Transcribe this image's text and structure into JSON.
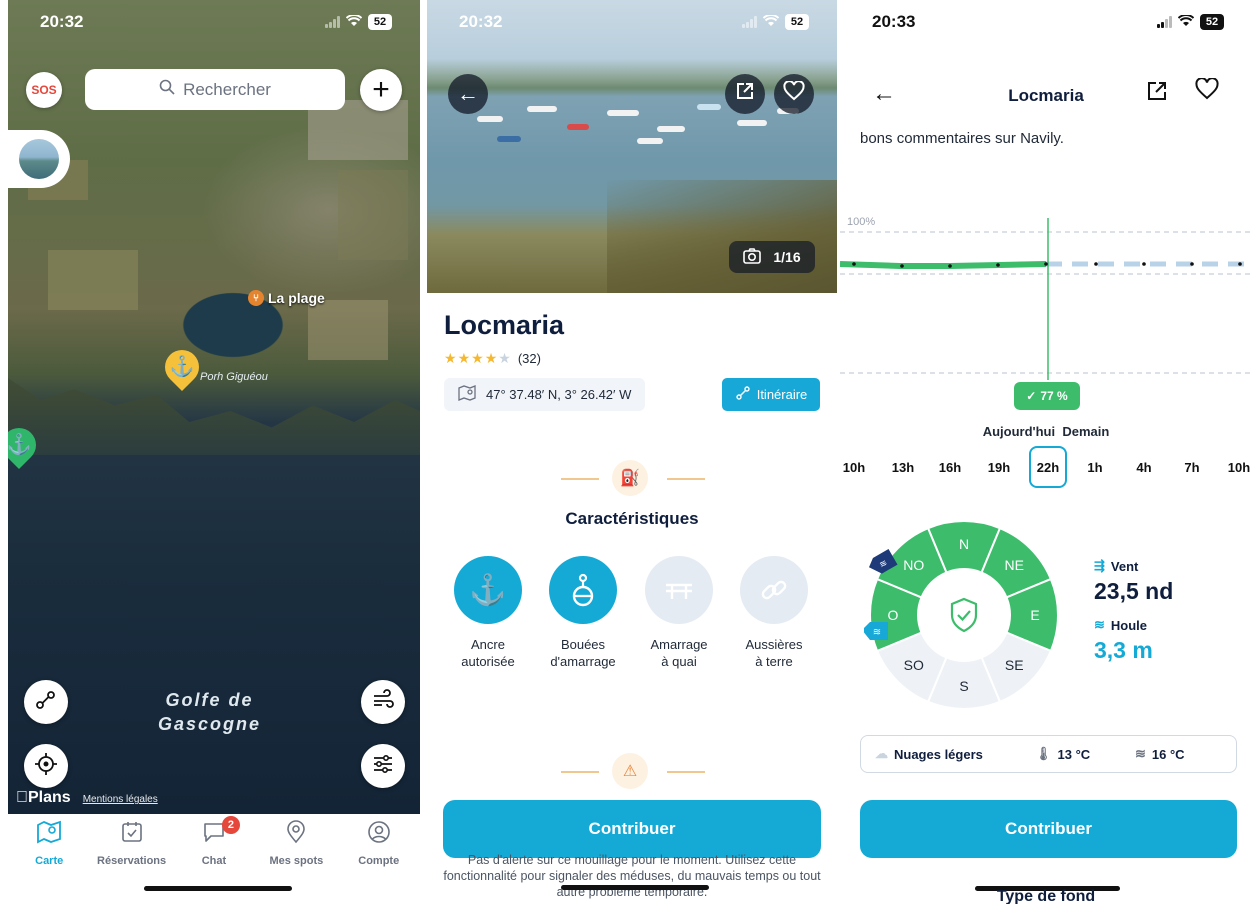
{
  "colors": {
    "accent": "#15a9d6",
    "navy": "#0f1e3d",
    "green": "#3dbd6c",
    "sos_red": "#e5473b",
    "star": "#f5b82e",
    "anchor_yellow": "#f6c13a",
    "anchor_green": "#2fb66b"
  },
  "panel_map": {
    "time": "20:32",
    "battery": "52",
    "sos_label": "SOS",
    "search": {
      "placeholder": "Rechercher",
      "icon": "search-icon"
    },
    "poi_label": "La plage",
    "anchorage_label": "Porh Giguéou",
    "sea_label_line1": "Golfe de",
    "sea_label_line2": "Gascogne",
    "plans_label": "Plans",
    "legal_label": "Mentions légales",
    "tabs": [
      {
        "label": "Carte",
        "icon": "map-icon",
        "active": true
      },
      {
        "label": "Réservations",
        "icon": "calendar-check-icon"
      },
      {
        "label": "Chat",
        "icon": "chat-bubble-icon",
        "badge": "2"
      },
      {
        "label": "Mes spots",
        "icon": "location-pin-icon"
      },
      {
        "label": "Compte",
        "icon": "account-icon"
      }
    ]
  },
  "panel_detail": {
    "time": "20:32",
    "battery": "52",
    "photo_counter": "1/16",
    "title": "Locmaria",
    "rating": {
      "stars": 4.5,
      "count_text": "(32)"
    },
    "coordinates": "47° 37.48′ N, 3° 26.42′ W",
    "itinerary_label": "Itinéraire",
    "section_title": "Caractéristiques",
    "features": [
      {
        "name": "Ancre\nautorisée",
        "icon": "anchor-icon",
        "enabled": true
      },
      {
        "name": "Bouées\nd'amarrage",
        "icon": "mooring-buoy-icon",
        "enabled": true
      },
      {
        "name": "Amarrage\nà quai",
        "icon": "quay-icon",
        "enabled": false
      },
      {
        "name": "Aussières\nà terre",
        "icon": "shore-line-icon",
        "enabled": false
      }
    ],
    "contribute_label": "Contribuer",
    "alert_text": "Pas d'alerte sur ce mouillage pour le moment. Utilisez cette fonctionnalité pour signaler des méduses, du mauvais temps ou tout autre problème temporaire."
  },
  "panel_forecast": {
    "time": "20:33",
    "battery": "52",
    "title": "Locmaria",
    "description_line": "bons commentaires sur Navily.",
    "chart_top_label": "100%",
    "safety_badge": "77 %",
    "day_today": "Aujourd'hui",
    "day_tomorrow": "Demain",
    "hours": [
      "10h",
      "13h",
      "16h",
      "19h",
      "22h",
      "1h",
      "4h",
      "7h",
      "10h"
    ],
    "selected_hour_index": 4,
    "compass": [
      "N",
      "NE",
      "E",
      "SE",
      "S",
      "SO",
      "O",
      "NO"
    ],
    "compass_safe": [
      true,
      true,
      true,
      false,
      false,
      false,
      true,
      true
    ],
    "wind": {
      "label": "Vent",
      "value": "23,5 nd"
    },
    "swell": {
      "label": "Houle",
      "value": "3,3 m"
    },
    "weather": {
      "sky": "Nuages légers",
      "air_temp": "13 °C",
      "water_temp": "16 °C"
    },
    "contribute_label": "Contribuer",
    "next_section": "Type de fond"
  }
}
